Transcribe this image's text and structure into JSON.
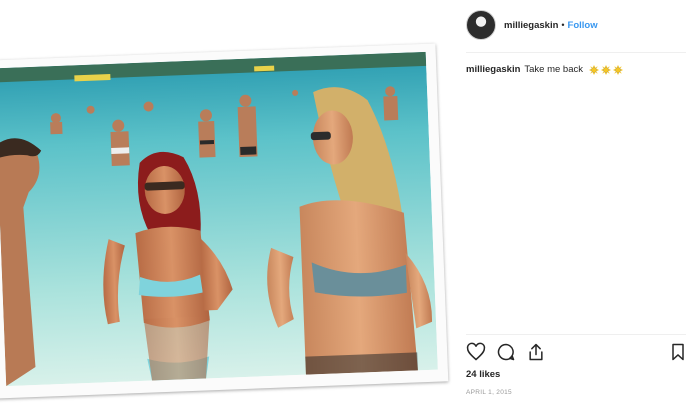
{
  "post": {
    "image_alt": "Two friends in bikinis standing in clear turquoise sea water at a crowded beach"
  },
  "header": {
    "username": "milliegaskin",
    "separator": "•",
    "follow_label": "Follow"
  },
  "caption": {
    "username": "milliegaskin",
    "text": "Take me back",
    "emoji": [
      "sun-emoji",
      "sun-emoji",
      "sun-emoji"
    ]
  },
  "actions": {
    "icons": [
      "heart-icon",
      "comment-icon",
      "share-icon",
      "bookmark-icon"
    ]
  },
  "stats": {
    "likes": "24 likes",
    "date": "APRIL 1, 2015"
  },
  "colors": {
    "link": "#3897f0",
    "text": "#262626",
    "muted": "#999999",
    "sea": "#6cc9cf",
    "bikini": "#7fd3dc"
  }
}
